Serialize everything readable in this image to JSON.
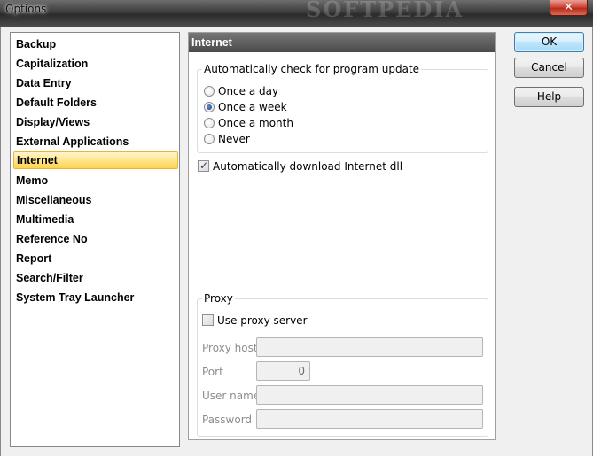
{
  "window": {
    "title": "Options",
    "watermark": "SOFTPEDIA",
    "close_glyph": "✕"
  },
  "nav": {
    "items": [
      {
        "label": "Backup",
        "selected": false
      },
      {
        "label": "Capitalization",
        "selected": false
      },
      {
        "label": "Data Entry",
        "selected": false
      },
      {
        "label": "Default Folders",
        "selected": false
      },
      {
        "label": "Display/Views",
        "selected": false
      },
      {
        "label": "External Applications",
        "selected": false
      },
      {
        "label": "Internet",
        "selected": true
      },
      {
        "label": "Memo",
        "selected": false
      },
      {
        "label": "Miscellaneous",
        "selected": false
      },
      {
        "label": "Multimedia",
        "selected": false
      },
      {
        "label": "Reference No",
        "selected": false
      },
      {
        "label": "Report",
        "selected": false
      },
      {
        "label": "Search/Filter",
        "selected": false
      },
      {
        "label": "System Tray Launcher",
        "selected": false
      }
    ]
  },
  "panel": {
    "header": "Internet",
    "update_group": {
      "legend": "Automatically check for program update",
      "options": [
        {
          "label": "Once a day",
          "checked": false
        },
        {
          "label": "Once a week",
          "checked": true
        },
        {
          "label": "Once a month",
          "checked": false
        },
        {
          "label": "Never",
          "checked": false
        }
      ]
    },
    "auto_download": {
      "label": "Automatically download Internet dll",
      "checked": true
    },
    "proxy_group": {
      "legend": "Proxy",
      "use_proxy": {
        "label": "Use proxy server",
        "checked": false
      },
      "host_label": "Proxy host",
      "host_value": "",
      "port_label": "Port",
      "port_value": "0",
      "user_label": "User name",
      "user_value": "",
      "password_label": "Password",
      "password_value": ""
    }
  },
  "buttons": {
    "ok": "OK",
    "cancel": "Cancel",
    "help": "Help"
  }
}
